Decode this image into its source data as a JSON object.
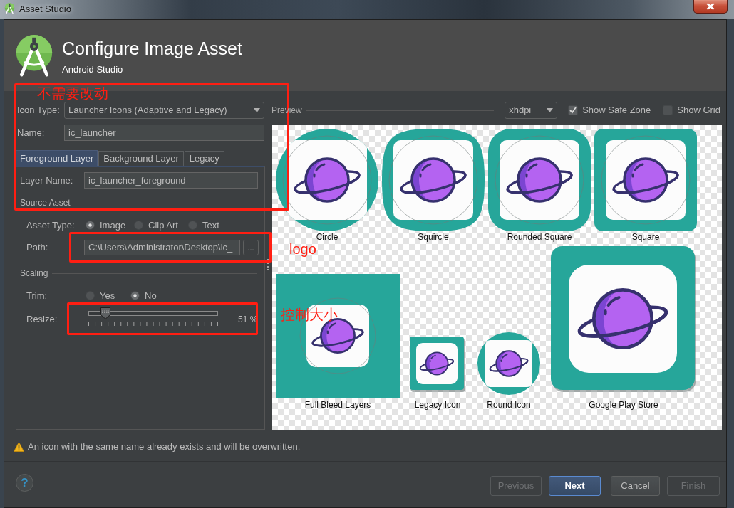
{
  "window": {
    "title": "Asset Studio"
  },
  "header": {
    "title": "Configure Image Asset",
    "subtitle": "Android Studio"
  },
  "form": {
    "icon_type": {
      "label": "Icon Type:",
      "value": "Launcher Icons (Adaptive and Legacy)"
    },
    "name": {
      "label": "Name:",
      "value": "ic_launcher"
    }
  },
  "tabs": [
    {
      "label": "Foreground Layer",
      "selected": true
    },
    {
      "label": "Background Layer",
      "selected": false
    },
    {
      "label": "Legacy",
      "selected": false
    }
  ],
  "layer": {
    "layer_name": {
      "label": "Layer Name:",
      "value": "ic_launcher_foreground"
    },
    "source_asset": {
      "title": "Source Asset",
      "asset_type": {
        "label": "Asset Type:",
        "options": [
          {
            "label": "Image",
            "selected": true
          },
          {
            "label": "Clip Art",
            "selected": false
          },
          {
            "label": "Text",
            "selected": false
          }
        ]
      },
      "path": {
        "label": "Path:",
        "value": "C:\\Users\\Administrator\\Desktop\\ic_",
        "browse": "..."
      }
    },
    "scaling": {
      "title": "Scaling",
      "trim": {
        "label": "Trim:",
        "options": [
          {
            "label": "Yes",
            "selected": false
          },
          {
            "label": "No",
            "selected": true
          }
        ]
      },
      "resize": {
        "label": "Resize:",
        "level": 0.13,
        "reading": "51 %"
      }
    }
  },
  "preview": {
    "title": "Preview",
    "density": "xhdpi",
    "show_safe_zone": {
      "label": "Show Safe Zone",
      "checked": true
    },
    "show_grid": {
      "label": "Show Grid",
      "checked": false
    },
    "rows": [
      {
        "icons": [
          {
            "label": "Circle",
            "kind": "circle"
          },
          {
            "label": "Squircle",
            "kind": "squircle"
          },
          {
            "label": "Rounded Square",
            "kind": "rounded_square"
          },
          {
            "label": "Square",
            "kind": "square"
          }
        ]
      },
      {
        "icons": [
          {
            "label": "Full Bleed Layers",
            "kind": "full_bleed"
          },
          {
            "label": "Legacy Icon",
            "kind": "legacy"
          },
          {
            "label": "Round Icon",
            "kind": "round"
          },
          {
            "label": "Google Play Store",
            "kind": "play_store"
          }
        ]
      }
    ]
  },
  "warning": "An icon with the same name already exists and will be overwritten.",
  "help": "?",
  "buttons": [
    {
      "label": "Previous",
      "disabled": true,
      "default": false
    },
    {
      "label": "Next",
      "disabled": false,
      "default": true
    },
    {
      "label": "Cancel",
      "disabled": false,
      "default": false
    },
    {
      "label": "Finish",
      "disabled": true,
      "default": false
    }
  ],
  "annotations": [
    {
      "text": "不需要改动"
    },
    {
      "text": "logo"
    },
    {
      "text": "控制大小"
    }
  ]
}
